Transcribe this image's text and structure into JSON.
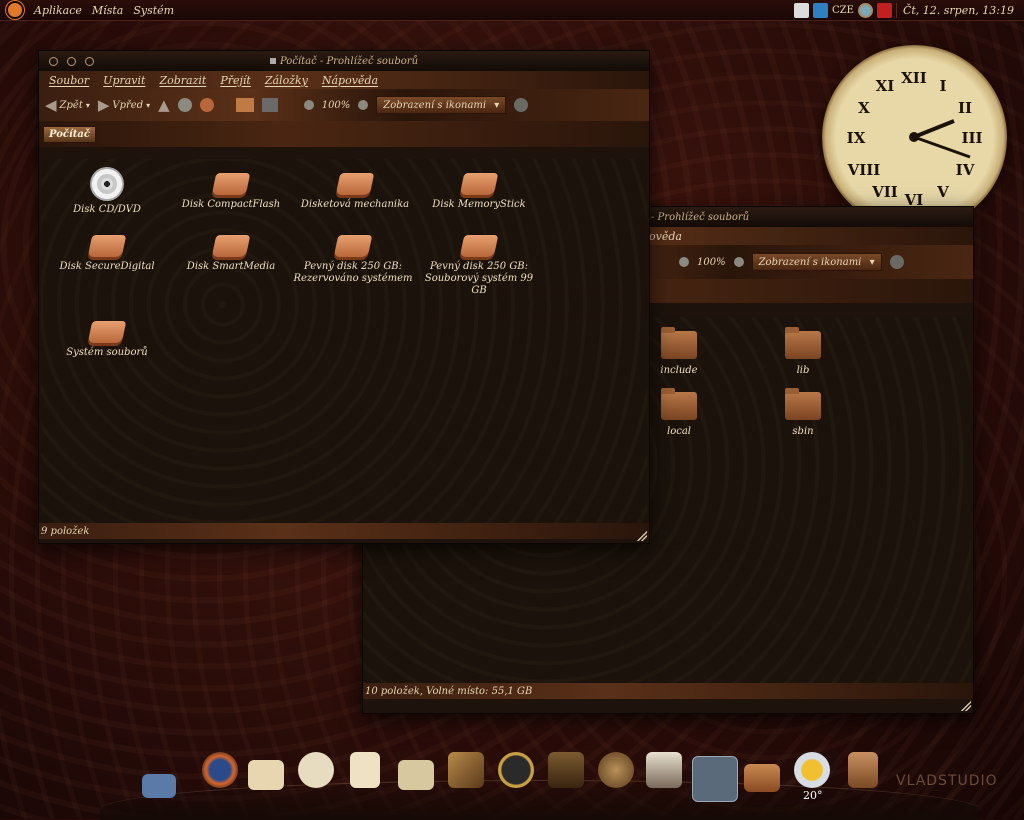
{
  "top_panel": {
    "menus": [
      "Aplikace",
      "Místa",
      "Systém"
    ],
    "keyboard_layout": "CZE",
    "clock": "Čt, 12. srpen, 13:19"
  },
  "front_window": {
    "title": "Počítač - Prohlížeč souborů",
    "menu": [
      "Soubor",
      "Upravit",
      "Zobrazit",
      "Přejít",
      "Záložky",
      "Nápověda"
    ],
    "toolbar": {
      "back_label": "Zpět",
      "forward_label": "Vpřed",
      "zoom": "100%",
      "view_mode": "Zobrazení s ikonami"
    },
    "location_crumb": "Počítač",
    "items": [
      {
        "label": "Disk CD/DVD",
        "icon": "cd-icon"
      },
      {
        "label": "Disk CompactFlash",
        "icon": "disk-icon"
      },
      {
        "label": "Disketová mechanika",
        "icon": "disk-icon"
      },
      {
        "label": "Disk MemoryStick",
        "icon": "disk-icon"
      },
      {
        "label": "Disk SecureDigital",
        "icon": "disk-icon"
      },
      {
        "label": "Disk SmartMedia",
        "icon": "disk-icon"
      },
      {
        "label": "Pevný disk 250 GB: Rezervováno systémem",
        "icon": "disk-icon"
      },
      {
        "label": "Pevný disk 250 GB: Souborový systém 99 GB",
        "icon": "disk-icon"
      },
      {
        "label": "Systém souborů",
        "icon": "disk-icon"
      }
    ],
    "status": "9 položek"
  },
  "back_window": {
    "title_visible": "- Prohlížeč souborů",
    "menu_visible": "ověda",
    "toolbar": {
      "zoom": "100%",
      "view_mode": "Zobrazení s ikonami"
    },
    "items": [
      {
        "label": "include",
        "icon": "folder-icon"
      },
      {
        "label": "lib",
        "icon": "folder-icon"
      },
      {
        "label": "local",
        "icon": "folder-icon"
      },
      {
        "label": "sbin",
        "icon": "folder-icon"
      }
    ],
    "status": "10 položek, Volné místo: 55,1 GB"
  },
  "dock": {
    "icons": [
      "network-icon",
      "firefox-icon",
      "mail-icon",
      "chat-icon",
      "document-icon",
      "window-icon",
      "telescope-icon",
      "compass-icon",
      "phone-icon",
      "globe-icon",
      "books-icon",
      "home-folder-icon",
      "folder-icon",
      "weather-icon",
      "trash-icon"
    ],
    "weather_temp": "20°",
    "watermark": "VLADSTUDIO"
  }
}
